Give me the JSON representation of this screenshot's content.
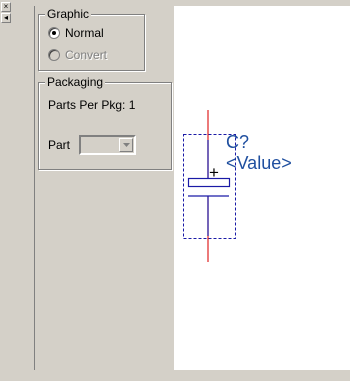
{
  "sidebar_strip": {
    "close_glyph": "×",
    "pin_glyph": "◂"
  },
  "graphic_group": {
    "title": "Graphic",
    "normal_label": "Normal",
    "normal_selected": true,
    "convert_label": "Convert",
    "convert_enabled": false
  },
  "packaging_group": {
    "title": "Packaging",
    "parts_per_pkg_label": "Parts Per Pkg: 1",
    "part_label": "Part",
    "part_value": ""
  },
  "canvas": {
    "reference_label": "C?",
    "value_label": "<Value>",
    "label_color": "#1f4f9f",
    "pin_color": "#e02020",
    "body_color": "#1a1aa6",
    "selection_color": "#1a1aa6"
  }
}
